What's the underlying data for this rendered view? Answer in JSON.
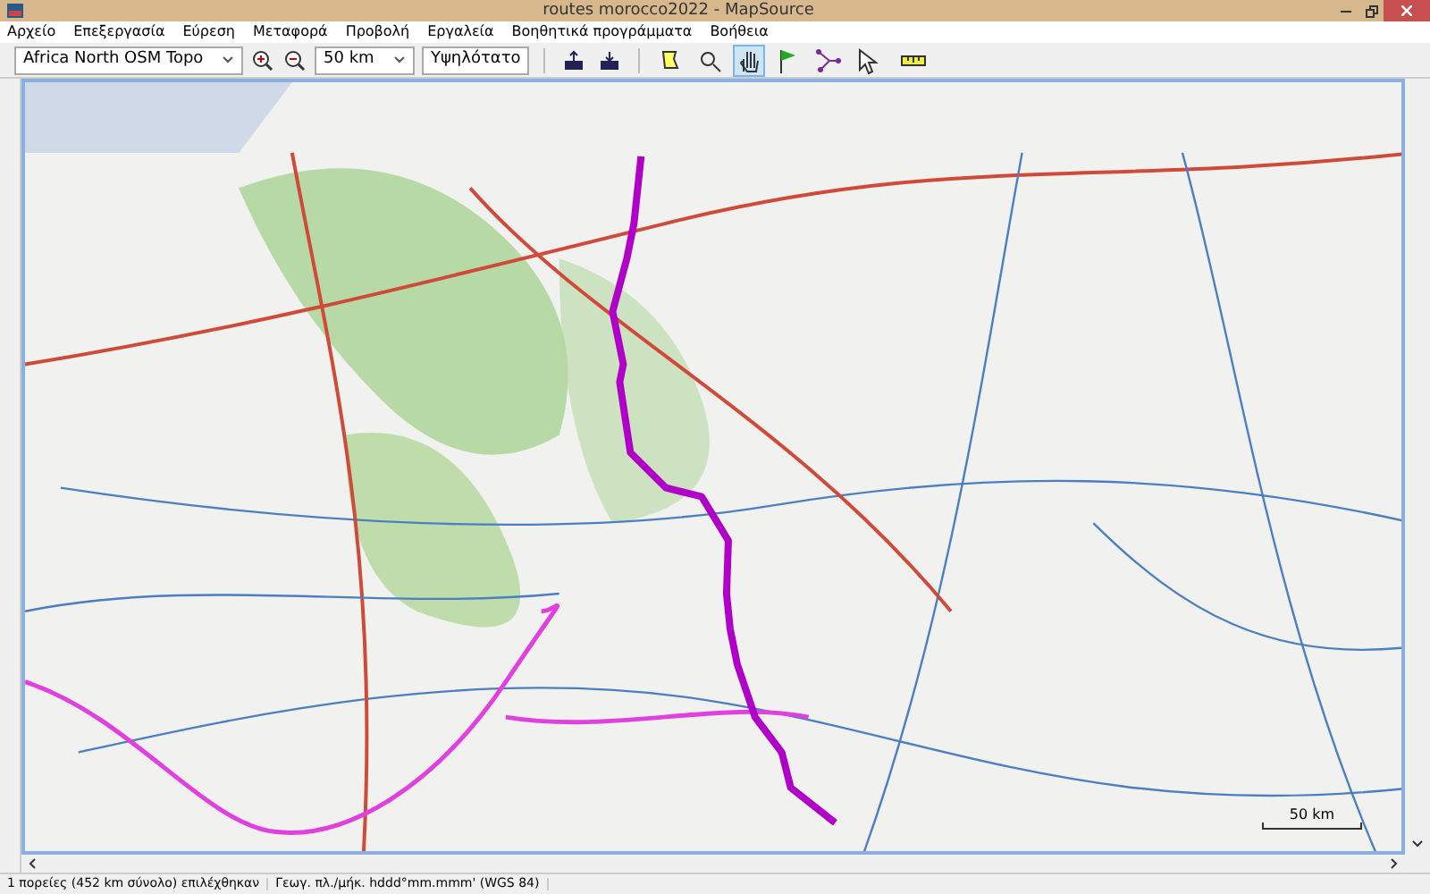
{
  "window": {
    "title": "routes morocco2022 - MapSource"
  },
  "menu": [
    "Αρχείο",
    "Επεξεργασία",
    "Εύρεση",
    "Μεταφορά",
    "Προβολή",
    "Εργαλεία",
    "Βοηθητικά προγράμματα",
    "Βοήθεια"
  ],
  "toolbar": {
    "map_product": "Africa North OSM Topo",
    "zoom_scale": "50 km",
    "detail": "Υψηλότατο",
    "tools": [
      {
        "kind": "select",
        "selected": false
      },
      {
        "kind": "zoom",
        "selected": false
      },
      {
        "kind": "hand",
        "selected": true
      },
      {
        "kind": "flag",
        "selected": false
      },
      {
        "kind": "route",
        "selected": false
      },
      {
        "kind": "arrow",
        "selected": false
      }
    ]
  },
  "map": {
    "scale_label": "50 km"
  },
  "status_bar": [
    "1 πορείες (452 km σύνολο) επιλέχθηκαν",
    "Γεωγ. πλ./μήκ. hddd°mm.mmm' (WGS 84)"
  ]
}
